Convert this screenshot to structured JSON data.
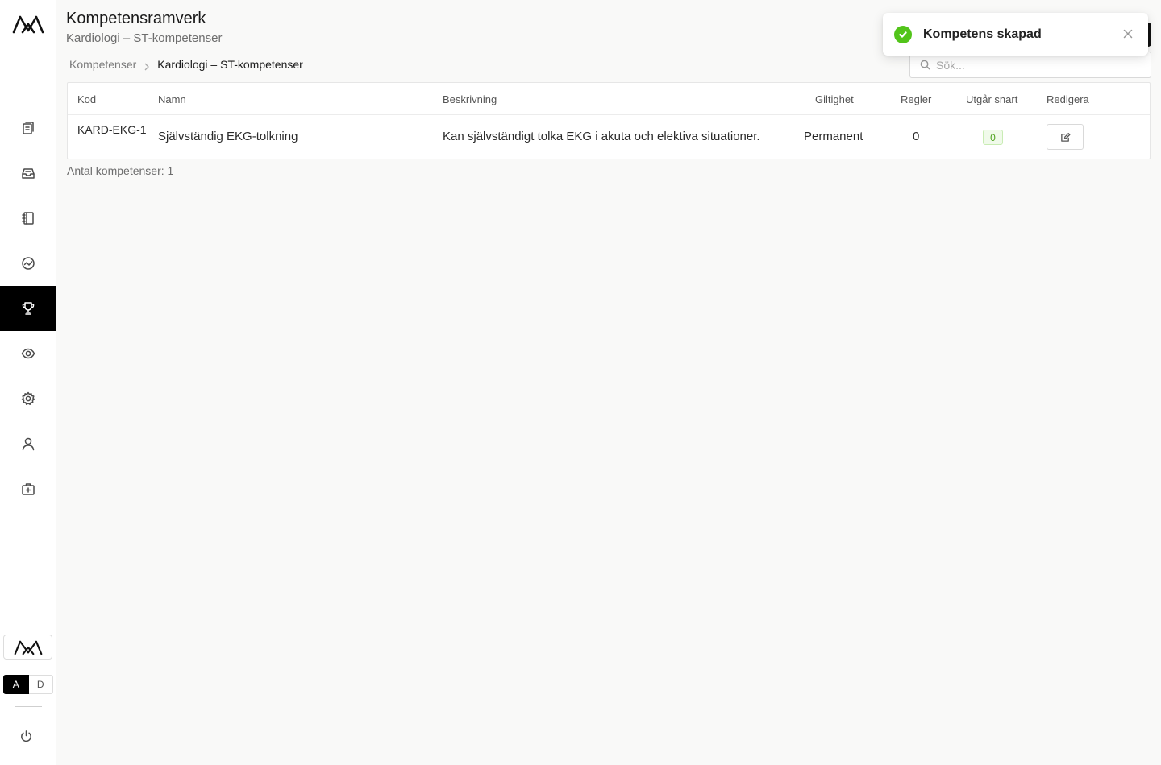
{
  "colors": {
    "accent": "#000000",
    "success": "#52c41a",
    "badge_bg": "#f0faea",
    "background": "#f9f9f8"
  },
  "sidebar": {
    "logo_icon": "brand-logo-icon",
    "items": [
      {
        "name": "documents",
        "icon": "document-copy-icon",
        "active": false
      },
      {
        "name": "inbox",
        "icon": "inbox-icon",
        "active": false
      },
      {
        "name": "notebook",
        "icon": "notebook-icon",
        "active": false
      },
      {
        "name": "dashboard",
        "icon": "chart-circle-icon",
        "active": false
      },
      {
        "name": "competencies",
        "icon": "trophy-icon",
        "active": true
      },
      {
        "name": "view",
        "icon": "eye-icon",
        "active": false
      },
      {
        "name": "settings",
        "icon": "gear-icon",
        "active": false
      },
      {
        "name": "user",
        "icon": "user-icon",
        "active": false
      },
      {
        "name": "medical",
        "icon": "medical-kit-icon",
        "active": false
      }
    ],
    "language": {
      "option_a": "A",
      "option_b": "D",
      "selected": "A"
    },
    "power_icon": "power-icon"
  },
  "header": {
    "title": "Kompetensramverk",
    "subtitle": "Kardiologi – ST-kompetenser"
  },
  "breadcrumb": {
    "items": [
      "Kompetenser",
      "Kardiologi – ST-kompetenser"
    ]
  },
  "search": {
    "placeholder": "Sök...",
    "value": ""
  },
  "table": {
    "columns": [
      "Kod",
      "Namn",
      "Beskrivning",
      "Giltighet",
      "Regler",
      "Utgår snart",
      "Redigera"
    ],
    "rows": [
      {
        "code": "KARD-EKG-1",
        "name": "Självständig EKG-tolkning",
        "description": "Kan självständigt tolka EKG i akuta och elektiva situationer.",
        "validity": "Permanent",
        "rules": "0",
        "expiring_soon": "0"
      }
    ]
  },
  "footer": {
    "count_text": "Antal kompetenser: 1"
  },
  "toast": {
    "message": "Kompetens skapad",
    "icon": "check-circle-icon",
    "close_icon": "close-icon"
  }
}
